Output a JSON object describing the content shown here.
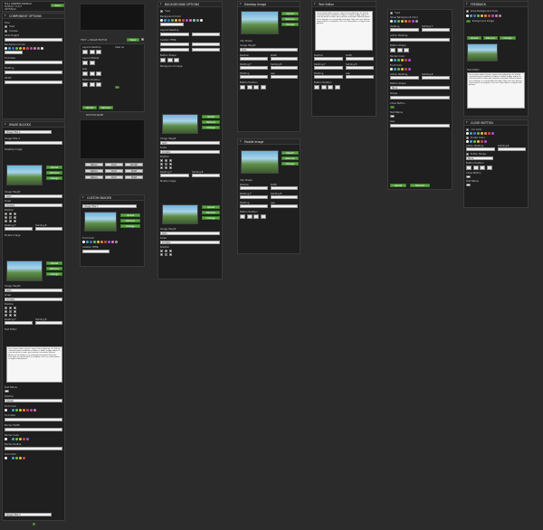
{
  "header": {
    "title_line1": "FULL SCREEN OVERLAY",
    "title_line2": "MOBILE / HALF",
    "title_line3": "SETTINGS",
    "save_label": "Save"
  },
  "panels": {
    "component_options": "COMPONENT OPTIONS",
    "image_blocks": "IMAGE BLOCKS",
    "background_options": "BACKGROUND OPTIONS",
    "feedback": "FEEDBACK",
    "close_button": "CLOSE BUTTON",
    "custom_buider": "CUSTOM BUIDER",
    "text_image_editor": "TEXT + IMAGE EDITOR",
    "button_name": "BUTTON NAME"
  },
  "labels": {
    "wide_height": "Wide Height",
    "background_color": "Background Color",
    "text": "Text",
    "desktop_image": "Desktop Image",
    "mobile_image": "Mobile Image",
    "image_title_1": "Image Title 1",
    "image_title_2": "Image Title 2",
    "image_title_3": "Image Title 3",
    "title": "Title",
    "upload": "Upload",
    "remove": "Remove",
    "change": "Change",
    "image_height": "Image Height",
    "position": "Position",
    "padding_top": "Padding T",
    "padding_bottom": "Padding B",
    "text_editor": "Text Editor",
    "preview": "Preview",
    "fixed": "Fixed",
    "show_background_color": "Show Background Color",
    "padding": "Padding",
    "width": "Width",
    "border_width": "Border Width",
    "close_button": "Close Button",
    "shape": "Shape",
    "font_size": "Font Size",
    "font_color": "Font Color",
    "action_padding": "Action Padding",
    "border_color": "Border Color",
    "border_radius": "Border Radius",
    "icon_color": "Icon Color",
    "button_shape": "Button Shape",
    "button_position": "Button Position",
    "background_image": "Background Image",
    "layout_desktop": "Layout Desktop",
    "layout_mobile": "Layout Mobile",
    "custom_html": "Custom HTML",
    "scale": "Scale",
    "gap": "Gap",
    "contain": "Contain",
    "auto": "Auto",
    "none": "None",
    "center": "Center",
    "text_below": "Text Below",
    "view_as": "View as",
    "clip_shape": "Clip Shape"
  },
  "button_options": {
    "before": "Before",
    "play": "PLAY",
    "pause": "PAUSE",
    "page": "PAGE"
  },
  "text_sample": "Lorem ipsum dolor sit amet, consectetur adipiscing elit. Sed do eiusmod tempor incididunt ut labore et dolore magna aliqua. Ut enim ad minim veniam, quis nostrud exercitation ullamco laboris nisi ut aliquip ex ea commodo consequat. Duis aute irure dolor in reprehenderit in voluptate velit esse cillum dolore eu fugiat nulla pariatur.",
  "palette": [
    "#ffffff",
    "#222222",
    "#3fa7d6",
    "#4f6bd8",
    "#6bbf59",
    "#e0c341",
    "#e58a3a",
    "#d64545",
    "#b04fd1",
    "#e472b6",
    "#7fd1c6",
    "#999999"
  ],
  "accent": "#5aa642"
}
